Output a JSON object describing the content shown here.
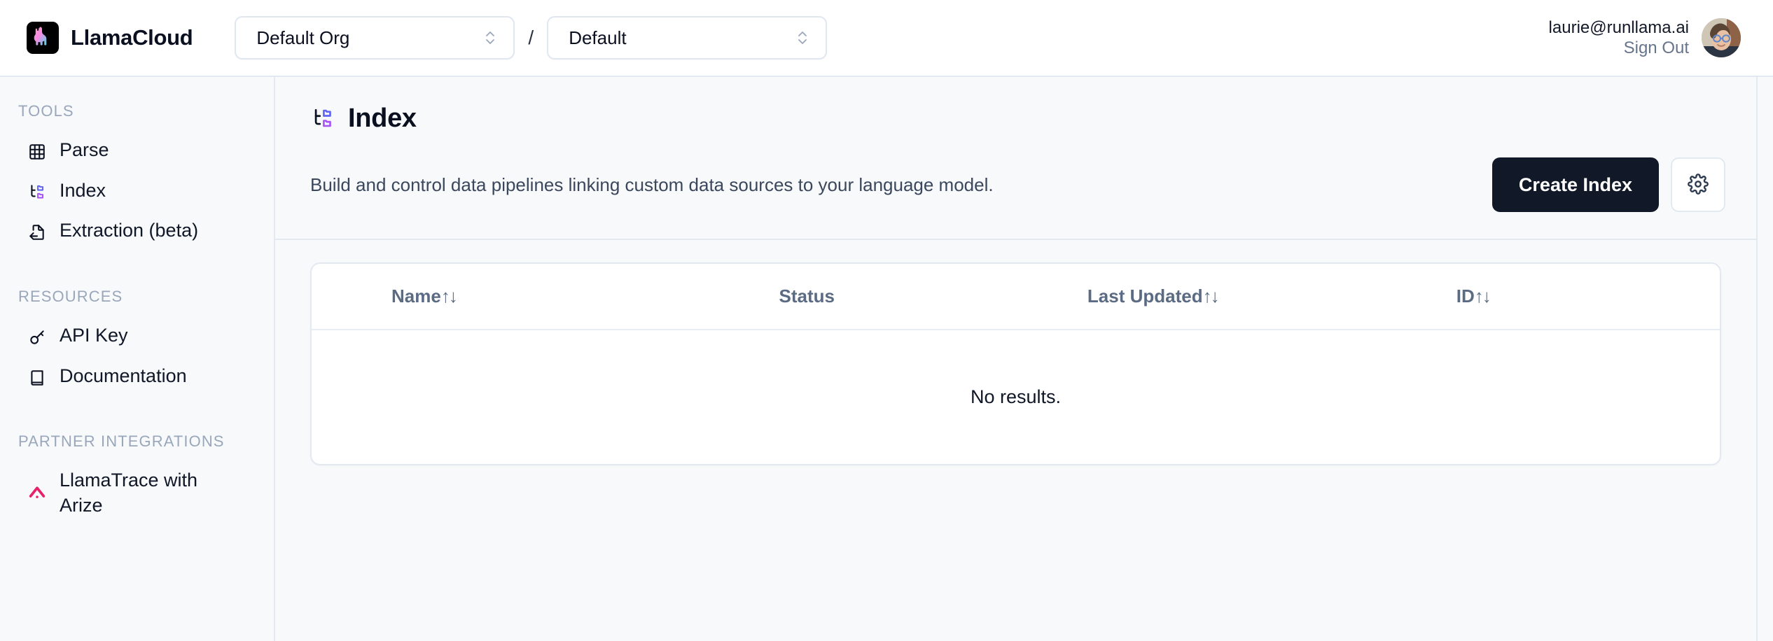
{
  "brand": {
    "name": "LlamaCloud",
    "logo_icon": "llama-logo-icon",
    "logo_bg": "#000000"
  },
  "header": {
    "org_select": {
      "value": "Default Org",
      "chevron_icon": "chevron-up-down-icon"
    },
    "separator": "/",
    "project_select": {
      "value": "Default",
      "chevron_icon": "chevron-up-down-icon"
    },
    "account": {
      "email": "laurie@runllama.ai",
      "sign_out_label": "Sign Out",
      "avatar_icon": "user-avatar"
    }
  },
  "sidebar": {
    "groups": [
      {
        "title": "TOOLS",
        "items": [
          {
            "label": "Parse",
            "icon": "grid-table-icon"
          },
          {
            "label": "Index",
            "icon": "index-tree-icon"
          },
          {
            "label": "Extraction (beta)",
            "icon": "file-extract-icon"
          }
        ]
      },
      {
        "title": "RESOURCES",
        "items": [
          {
            "label": "API Key",
            "icon": "key-icon"
          },
          {
            "label": "Documentation",
            "icon": "book-icon"
          }
        ]
      },
      {
        "title": "PARTNER INTEGRATIONS",
        "items": [
          {
            "label": "LlamaTrace with Arize",
            "icon": "arize-chevron-icon"
          }
        ]
      }
    ]
  },
  "page": {
    "icon": "index-tree-icon",
    "title": "Index",
    "subtitle": "Build and control data pipelines linking custom data sources to your language model.",
    "primary_button": "Create Index",
    "settings_button_icon": "gear-icon"
  },
  "table": {
    "columns": [
      {
        "label": "Name",
        "sortable": true,
        "sort_glyph": "↑↓"
      },
      {
        "label": "Status",
        "sortable": false,
        "sort_glyph": ""
      },
      {
        "label": "Last Updated",
        "sortable": true,
        "sort_glyph": "↑↓"
      },
      {
        "label": "ID",
        "sortable": true,
        "sort_glyph": "↑↓"
      }
    ],
    "rows": [],
    "empty_message": "No results."
  },
  "colors": {
    "page_bg": "#f7f9fb",
    "border": "#e3e9f0",
    "primary_btn_bg": "#111827",
    "text_dark": "#0b1020",
    "text_muted": "#5b6b83",
    "accent_purple": "#8b5cf6",
    "accent_indigo": "#6366f1",
    "accent_pink": "#e8216b"
  }
}
